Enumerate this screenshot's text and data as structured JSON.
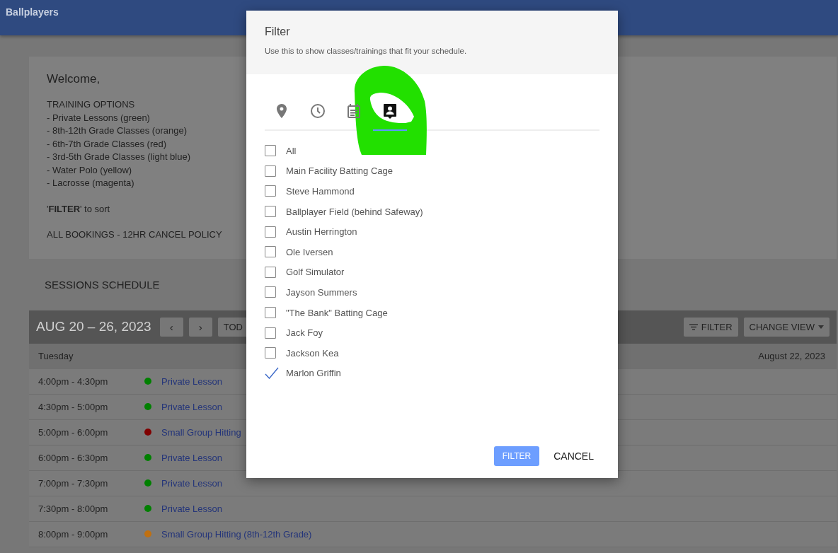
{
  "header": {
    "title": "Ballplayers"
  },
  "welcome": {
    "title": "Welcome,",
    "heading": "TRAINING OPTIONS",
    "options": [
      "- Private Lessons (green)",
      "- 8th-12th Grade Classes (orange)",
      "- 6th-7th Grade Classes (red)",
      "- 3rd-5th Grade Classes (light blue)",
      "- Water Polo (yellow)",
      "- Lacrosse (magenta)"
    ],
    "note": "'**FILTER**' to sort",
    "policy": "ALL BOOKINGS - 12HR CANCEL POLICY"
  },
  "schedule": {
    "title": "SESSIONS SCHEDULE",
    "range": "AUG 20 – 26, 2023",
    "prev": "‹",
    "next": "›",
    "today": "TOD",
    "filter": "FILTER",
    "change_view": "CHANGE VIEW",
    "day": "Tuesday",
    "date": "August 22, 2023",
    "rows": [
      {
        "time": "4:00pm - 4:30pm",
        "event": "Private Lesson",
        "color": "#008000"
      },
      {
        "time": "4:30pm - 5:00pm",
        "event": "Private Lesson",
        "color": "#008000"
      },
      {
        "time": "5:00pm - 6:00pm",
        "event": "Small Group Hitting",
        "color": "#800000"
      },
      {
        "time": "6:00pm - 6:30pm",
        "event": "Private Lesson",
        "color": "#008000"
      },
      {
        "time": "7:00pm - 7:30pm",
        "event": "Private Lesson",
        "color": "#008000"
      },
      {
        "time": "7:30pm - 8:00pm",
        "event": "Private Lesson",
        "color": "#008000"
      },
      {
        "time": "8:00pm - 9:00pm",
        "event": "Small Group Hitting (8th-12th Grade)",
        "color": "#c07010"
      }
    ]
  },
  "dialog": {
    "title": "Filter",
    "subtitle": "Use this to show classes/trainings that fit your schedule.",
    "tabs": [
      {
        "kind": "location",
        "selected": false
      },
      {
        "kind": "clock",
        "selected": false
      },
      {
        "kind": "calendar",
        "selected": false
      },
      {
        "kind": "contact",
        "selected": true
      }
    ],
    "options": [
      {
        "label": "All",
        "checked": false
      },
      {
        "label": "Main Facility Batting Cage",
        "checked": false
      },
      {
        "label": "Steve Hammond",
        "checked": false
      },
      {
        "label": "Ballplayer Field (behind Safeway)",
        "checked": false
      },
      {
        "label": "Austin Herrington",
        "checked": false
      },
      {
        "label": "Ole Iversen",
        "checked": false
      },
      {
        "label": "Golf Simulator",
        "checked": false
      },
      {
        "label": "Jayson Summers",
        "checked": false
      },
      {
        "label": "\"The Bank\" Batting Cage",
        "checked": false
      },
      {
        "label": "Jack Foy",
        "checked": false
      },
      {
        "label": "Jackson Kea",
        "checked": false
      },
      {
        "label": "Marlon Griffin",
        "checked": true
      }
    ],
    "buttons": [
      "FILTER",
      "CANCEL"
    ]
  }
}
